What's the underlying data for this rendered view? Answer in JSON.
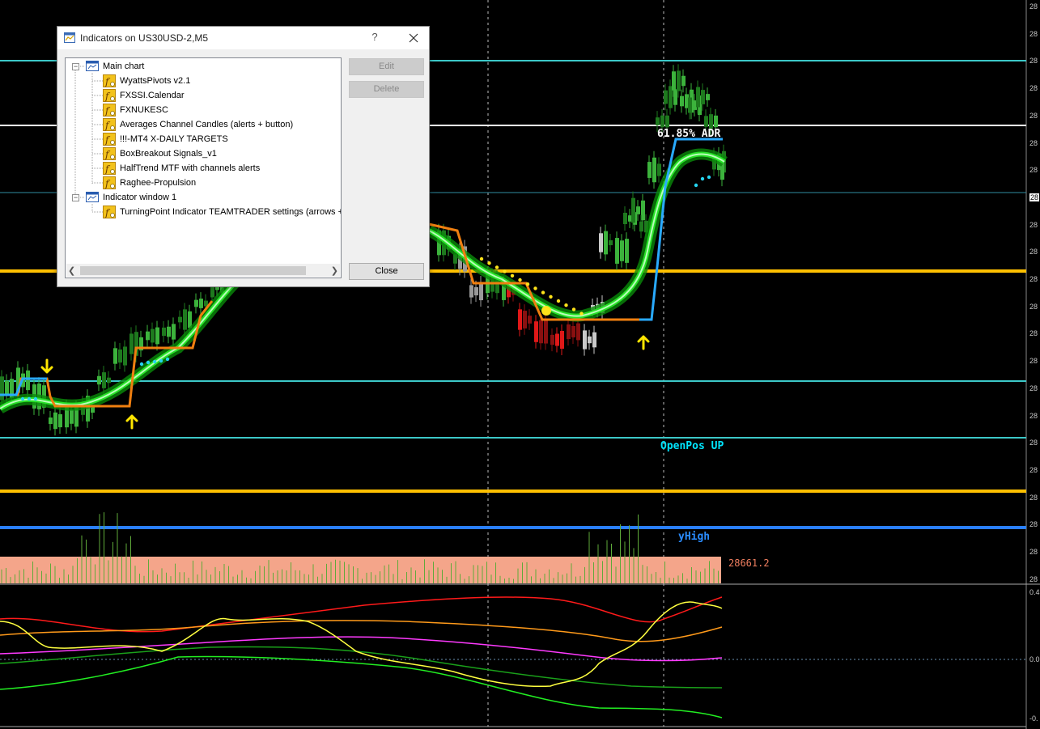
{
  "chart": {
    "adr_label": "61.85% ADR",
    "openpos_label": "OpenPos UP",
    "yhigh_label": "yHigh",
    "price_label": "28661.2",
    "axis_ticks": [
      "28",
      "28",
      "28",
      "28",
      "28",
      "28",
      "28",
      "28",
      "28",
      "28",
      "28",
      "28",
      "28",
      "28",
      "28",
      "28",
      "28",
      "28",
      "28",
      "28",
      "28",
      "28"
    ],
    "subwindow_ticks": [
      "0.4",
      "0.0",
      "-0."
    ],
    "colors": {
      "cyan_line": "#3cc8c8",
      "white_line": "#ffffff",
      "gold_line": "#ffc000",
      "blue_line": "#2a7fff",
      "salmon_block": "#f4a58a"
    }
  },
  "dialog": {
    "title": "Indicators on US30USD-2,M5",
    "help_label": "?",
    "tree": {
      "main_chart": {
        "label": "Main chart",
        "items": [
          "WyattsPivots v2.1",
          "FXSSI.Calendar",
          "FXNUKESC",
          "Averages Channel Candles  (alerts + button)",
          "!!!-MT4 X-DAILY TARGETS",
          "BoxBreakout Signals_v1",
          "HalfTrend MTF with channels alerts",
          "Raghee-Propulsion"
        ]
      },
      "indicator_window": {
        "label": "Indicator window 1",
        "items": [
          "TurningPoint Indicator TEAMTRADER settings (arrows + a"
        ]
      }
    },
    "buttons": {
      "edit": "Edit",
      "delete": "Delete",
      "close": "Close"
    }
  }
}
